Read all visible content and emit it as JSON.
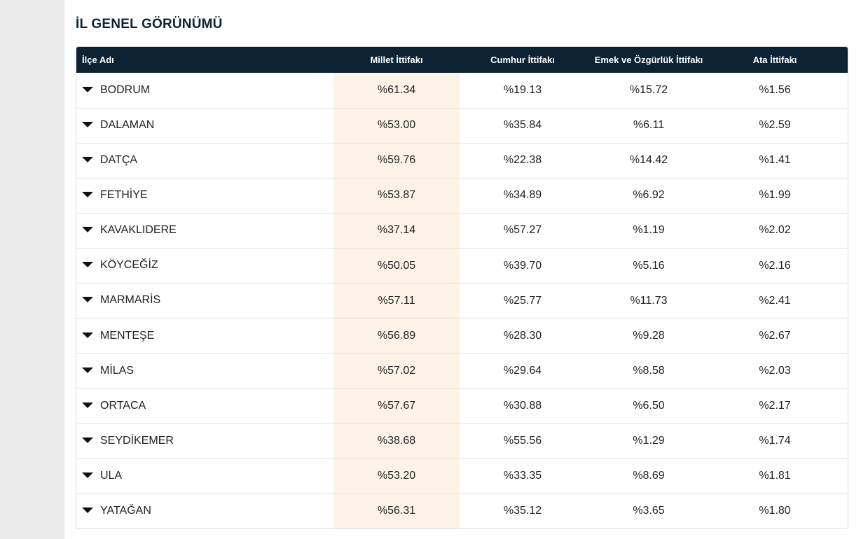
{
  "page": {
    "title": "İL GENEL GÖRÜNÜMÜ"
  },
  "colors": {
    "header_bg": "#0d2233",
    "highlight_column": "#fdf3e7",
    "left_rail": "#eaeaea"
  },
  "table": {
    "headers": {
      "name": "İlçe Adı",
      "millet": "Millet İttifakı",
      "cumhur": "Cumhur İttifakı",
      "emek": "Emek ve Özgürlük İttifakı",
      "ata": "Ata İttifakı"
    },
    "rows": [
      {
        "name": "BODRUM",
        "millet": "%61.34",
        "cumhur": "%19.13",
        "emek": "%15.72",
        "ata": "%1.56"
      },
      {
        "name": "DALAMAN",
        "millet": "%53.00",
        "cumhur": "%35.84",
        "emek": "%6.11",
        "ata": "%2.59"
      },
      {
        "name": "DATÇA",
        "millet": "%59.76",
        "cumhur": "%22.38",
        "emek": "%14.42",
        "ata": "%1.41"
      },
      {
        "name": "FETHİYE",
        "millet": "%53.87",
        "cumhur": "%34.89",
        "emek": "%6.92",
        "ata": "%1.99"
      },
      {
        "name": "KAVAKLIDERE",
        "millet": "%37.14",
        "cumhur": "%57.27",
        "emek": "%1.19",
        "ata": "%2.02"
      },
      {
        "name": "KÖYCEĞİZ",
        "millet": "%50.05",
        "cumhur": "%39.70",
        "emek": "%5.16",
        "ata": "%2.16"
      },
      {
        "name": "MARMARİS",
        "millet": "%57.11",
        "cumhur": "%25.77",
        "emek": "%11.73",
        "ata": "%2.41"
      },
      {
        "name": "MENTEŞE",
        "millet": "%56.89",
        "cumhur": "%28.30",
        "emek": "%9.28",
        "ata": "%2.67"
      },
      {
        "name": "MİLAS",
        "millet": "%57.02",
        "cumhur": "%29.64",
        "emek": "%8.58",
        "ata": "%2.03"
      },
      {
        "name": "ORTACA",
        "millet": "%57.67",
        "cumhur": "%30.88",
        "emek": "%6.50",
        "ata": "%2.17"
      },
      {
        "name": "SEYDİKEMER",
        "millet": "%38.68",
        "cumhur": "%55.56",
        "emek": "%1.29",
        "ata": "%1.74"
      },
      {
        "name": "ULA",
        "millet": "%53.20",
        "cumhur": "%33.35",
        "emek": "%8.69",
        "ata": "%1.81"
      },
      {
        "name": "YATAĞAN",
        "millet": "%56.31",
        "cumhur": "%35.12",
        "emek": "%3.65",
        "ata": "%1.80"
      }
    ]
  }
}
